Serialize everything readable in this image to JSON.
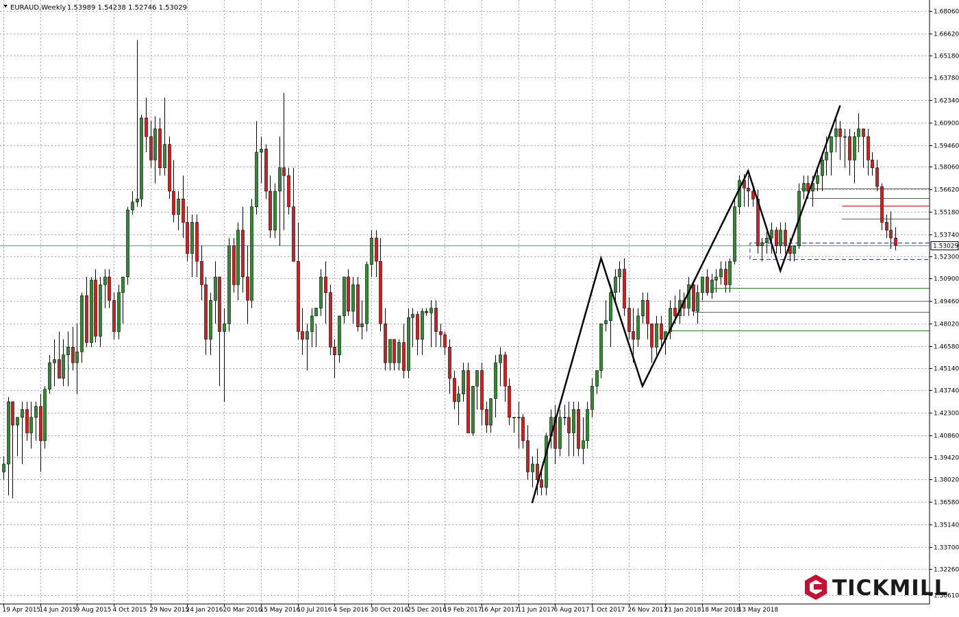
{
  "header": {
    "symbol": "EURAUD,Weekly",
    "ohlc": "1.53989 1.54238 1.52746 1.53029"
  },
  "brand": {
    "name": "TICKMILL",
    "logo_icon": "tickmill-hexagon-logo-icon",
    "color": "#c8102e"
  },
  "colors": {
    "bull": "#2e8b2e",
    "bear": "#d21e1e",
    "wick": "#000000",
    "grid": "#a9a9a9",
    "zigzag": "#000000",
    "resistance": "#e02020",
    "support": "#2e8b2e",
    "zone": "#2233cc",
    "current_price_line": "#7a8a99"
  },
  "chart_data": {
    "type": "candlestick",
    "title": "EURAUD,Weekly",
    "timeframe": "Weekly",
    "ylim": [
      1.3003,
      1.6876
    ],
    "y_ticks": [
      "1.30610",
      "1.32260",
      "1.33700",
      "1.35140",
      "1.36580",
      "1.38020",
      "1.39420",
      "1.40860",
      "1.42300",
      "1.43740",
      "1.45140",
      "1.46580",
      "1.48020",
      "1.49460",
      "1.50900",
      "1.52300",
      "1.53740",
      "1.55180",
      "1.56620",
      "1.58060",
      "1.59460",
      "1.60900",
      "1.62340",
      "1.63780",
      "1.65180",
      "1.66620",
      "1.68060"
    ],
    "x_ticks": [
      "19 Apr 2015",
      "14 Jun 2015",
      "9 Aug 2015",
      "4 Oct 2015",
      "29 Nov 2015",
      "24 Jan 2016",
      "20 Mar 2016",
      "15 May 2016",
      "10 Jul 2016",
      "4 Sep 2016",
      "30 Oct 2016",
      "25 Dec 2016",
      "19 Feb 2017",
      "16 Apr 2017",
      "11 Jun 2017",
      "6 Aug 2017",
      "1 Oct 2017",
      "26 Nov 2017",
      "21 Jan 2018",
      "18 Mar 2018",
      "13 May 2018"
    ],
    "first_week": "19 Apr 2015",
    "current_price": "1.53029",
    "grid": true,
    "candles": [
      [
        1.385,
        1.395,
        1.38,
        1.39
      ],
      [
        1.39,
        1.433,
        1.37,
        1.43
      ],
      [
        1.43,
        1.425,
        1.368,
        1.415
      ],
      [
        1.415,
        1.42,
        1.395,
        1.42
      ],
      [
        1.42,
        1.43,
        1.39,
        1.425
      ],
      [
        1.425,
        1.43,
        1.405,
        1.41
      ],
      [
        1.41,
        1.43,
        1.4,
        1.42
      ],
      [
        1.42,
        1.43,
        1.405,
        1.427
      ],
      [
        1.427,
        1.435,
        1.385,
        1.405
      ],
      [
        1.405,
        1.44,
        1.4,
        1.438
      ],
      [
        1.438,
        1.46,
        1.435,
        1.455
      ],
      [
        1.455,
        1.47,
        1.44,
        1.457
      ],
      [
        1.457,
        1.475,
        1.445,
        1.445
      ],
      [
        1.445,
        1.47,
        1.44,
        1.46
      ],
      [
        1.46,
        1.475,
        1.44,
        1.465
      ],
      [
        1.465,
        1.478,
        1.45,
        1.455
      ],
      [
        1.455,
        1.48,
        1.435,
        1.462
      ],
      [
        1.462,
        1.5,
        1.455,
        1.498
      ],
      [
        1.498,
        1.51,
        1.465,
        1.468
      ],
      [
        1.468,
        1.51,
        1.465,
        1.508
      ],
      [
        1.508,
        1.515,
        1.468,
        1.472
      ],
      [
        1.472,
        1.51,
        1.465,
        1.505
      ],
      [
        1.505,
        1.515,
        1.49,
        1.51
      ],
      [
        1.51,
        1.515,
        1.49,
        1.495
      ],
      [
        1.495,
        1.5,
        1.47,
        1.475
      ],
      [
        1.475,
        1.505,
        1.47,
        1.5
      ],
      [
        1.5,
        1.51,
        1.48,
        1.51
      ],
      [
        1.51,
        1.555,
        1.505,
        1.553
      ],
      [
        1.553,
        1.565,
        1.55,
        1.558
      ],
      [
        1.558,
        1.662,
        1.555,
        1.56
      ],
      [
        1.56,
        1.614,
        1.555,
        1.612
      ],
      [
        1.612,
        1.625,
        1.59,
        1.6
      ],
      [
        1.6,
        1.61,
        1.58,
        1.585
      ],
      [
        1.585,
        1.613,
        1.57,
        1.605
      ],
      [
        1.605,
        1.612,
        1.575,
        1.58
      ],
      [
        1.58,
        1.625,
        1.575,
        1.595
      ],
      [
        1.595,
        1.6,
        1.56,
        1.565
      ],
      [
        1.565,
        1.585,
        1.545,
        1.55
      ],
      [
        1.55,
        1.565,
        1.54,
        1.56
      ],
      [
        1.56,
        1.575,
        1.535,
        1.545
      ],
      [
        1.545,
        1.555,
        1.52,
        1.525
      ],
      [
        1.525,
        1.55,
        1.51,
        1.545
      ],
      [
        1.545,
        1.55,
        1.51,
        1.52
      ],
      [
        1.52,
        1.53,
        1.495,
        1.505
      ],
      [
        1.505,
        1.51,
        1.46,
        1.47
      ],
      [
        1.47,
        1.5,
        1.46,
        1.495
      ],
      [
        1.495,
        1.52,
        1.48,
        1.51
      ],
      [
        1.51,
        1.51,
        1.44,
        1.475
      ],
      [
        1.475,
        1.49,
        1.43,
        1.48
      ],
      [
        1.48,
        1.535,
        1.475,
        1.53
      ],
      [
        1.53,
        1.535,
        1.5,
        1.505
      ],
      [
        1.505,
        1.545,
        1.495,
        1.54
      ],
      [
        1.54,
        1.555,
        1.5,
        1.51
      ],
      [
        1.51,
        1.53,
        1.48,
        1.495
      ],
      [
        1.495,
        1.56,
        1.49,
        1.555
      ],
      [
        1.555,
        1.61,
        1.55,
        1.59
      ],
      [
        1.59,
        1.6,
        1.57,
        1.592
      ],
      [
        1.592,
        1.595,
        1.56,
        1.565
      ],
      [
        1.565,
        1.575,
        1.535,
        1.54
      ],
      [
        1.54,
        1.57,
        1.535,
        1.565
      ],
      [
        1.565,
        1.6,
        1.53,
        1.58
      ],
      [
        1.58,
        1.628,
        1.54,
        1.575
      ],
      [
        1.575,
        1.58,
        1.55,
        1.555
      ],
      [
        1.555,
        1.58,
        1.52,
        1.52
      ],
      [
        1.52,
        1.545,
        1.47,
        1.475
      ],
      [
        1.475,
        1.49,
        1.46,
        1.47
      ],
      [
        1.47,
        1.48,
        1.45,
        1.475
      ],
      [
        1.475,
        1.49,
        1.465,
        1.485
      ],
      [
        1.485,
        1.48,
        1.465,
        1.49
      ],
      [
        1.49,
        1.515,
        1.485,
        1.51
      ],
      [
        1.51,
        1.52,
        1.48,
        1.5
      ],
      [
        1.5,
        1.505,
        1.46,
        1.465
      ],
      [
        1.465,
        1.47,
        1.445,
        1.46
      ],
      [
        1.46,
        1.47,
        1.455,
        1.485
      ],
      [
        1.485,
        1.5,
        1.48,
        1.51
      ],
      [
        1.51,
        1.515,
        1.485,
        1.488
      ],
      [
        1.488,
        1.51,
        1.48,
        1.505
      ],
      [
        1.505,
        1.51,
        1.475,
        1.478
      ],
      [
        1.478,
        1.495,
        1.47,
        1.48
      ],
      [
        1.48,
        1.52,
        1.475,
        1.518
      ],
      [
        1.518,
        1.54,
        1.51,
        1.535
      ],
      [
        1.535,
        1.54,
        1.51,
        1.52
      ],
      [
        1.52,
        1.535,
        1.475,
        1.48
      ],
      [
        1.48,
        1.49,
        1.45,
        1.455
      ],
      [
        1.455,
        1.46,
        1.45,
        1.47
      ],
      [
        1.47,
        1.47,
        1.45,
        1.455
      ],
      [
        1.455,
        1.47,
        1.45,
        1.468
      ],
      [
        1.468,
        1.48,
        1.445,
        1.45
      ],
      [
        1.45,
        1.49,
        1.445,
        1.484
      ],
      [
        1.484,
        1.49,
        1.465,
        1.486
      ],
      [
        1.486,
        1.488,
        1.46,
        1.47
      ],
      [
        1.47,
        1.49,
        1.46,
        1.488
      ],
      [
        1.488,
        1.49,
        1.485,
        1.487
      ],
      [
        1.487,
        1.495,
        1.465,
        1.49
      ],
      [
        1.49,
        1.495,
        1.465,
        1.475
      ],
      [
        1.475,
        1.48,
        1.465,
        1.473
      ],
      [
        1.473,
        1.475,
        1.46,
        1.465
      ],
      [
        1.465,
        1.47,
        1.435,
        1.445
      ],
      [
        1.445,
        1.45,
        1.425,
        1.43
      ],
      [
        1.43,
        1.44,
        1.415,
        1.435
      ],
      [
        1.435,
        1.455,
        1.43,
        1.45
      ],
      [
        1.45,
        1.455,
        1.41,
        1.41
      ],
      [
        1.41,
        1.44,
        1.408,
        1.44
      ],
      [
        1.44,
        1.45,
        1.425,
        1.45
      ],
      [
        1.45,
        1.455,
        1.415,
        1.425
      ],
      [
        1.425,
        1.43,
        1.41,
        1.415
      ],
      [
        1.415,
        1.42,
        1.41,
        1.432
      ],
      [
        1.432,
        1.46,
        1.42,
        1.455
      ],
      [
        1.455,
        1.465,
        1.44,
        1.46
      ],
      [
        1.46,
        1.462,
        1.43,
        1.44
      ],
      [
        1.44,
        1.445,
        1.415,
        1.42
      ],
      [
        1.42,
        1.42,
        1.41,
        1.42
      ],
      [
        1.42,
        1.43,
        1.4,
        1.42
      ],
      [
        1.42,
        1.422,
        1.4,
        1.405
      ],
      [
        1.405,
        1.415,
        1.38,
        1.385
      ],
      [
        1.385,
        1.395,
        1.375,
        1.39
      ],
      [
        1.39,
        1.4,
        1.37,
        1.38
      ],
      [
        1.38,
        1.385,
        1.37,
        1.375
      ],
      [
        1.375,
        1.41,
        1.37,
        1.408
      ],
      [
        1.408,
        1.425,
        1.4,
        1.42
      ],
      [
        1.42,
        1.428,
        1.39,
        1.4
      ],
      [
        1.4,
        1.425,
        1.395,
        1.42
      ],
      [
        1.42,
        1.428,
        1.415,
        1.42
      ],
      [
        1.42,
        1.43,
        1.395,
        1.41
      ],
      [
        1.41,
        1.43,
        1.395,
        1.425
      ],
      [
        1.425,
        1.43,
        1.395,
        1.4
      ],
      [
        1.4,
        1.42,
        1.39,
        1.405
      ],
      [
        1.405,
        1.43,
        1.4,
        1.425
      ],
      [
        1.425,
        1.445,
        1.42,
        1.44
      ],
      [
        1.44,
        1.45,
        1.435,
        1.45
      ],
      [
        1.45,
        1.48,
        1.445,
        1.48
      ],
      [
        1.48,
        1.495,
        1.475,
        1.482
      ],
      [
        1.482,
        1.505,
        1.465,
        1.5
      ],
      [
        1.5,
        1.515,
        1.495,
        1.51
      ],
      [
        1.51,
        1.52,
        1.5,
        1.515
      ],
      [
        1.515,
        1.522,
        1.485,
        1.49
      ],
      [
        1.49,
        1.497,
        1.47,
        1.475
      ],
      [
        1.475,
        1.49,
        1.455,
        1.47
      ],
      [
        1.47,
        1.49,
        1.465,
        1.485
      ],
      [
        1.485,
        1.5,
        1.48,
        1.495
      ],
      [
        1.495,
        1.5,
        1.47,
        1.48
      ],
      [
        1.48,
        1.48,
        1.455,
        1.465
      ],
      [
        1.465,
        1.485,
        1.46,
        1.48
      ],
      [
        1.48,
        1.485,
        1.465,
        1.47
      ],
      [
        1.47,
        1.475,
        1.46,
        1.475
      ],
      [
        1.475,
        1.495,
        1.47,
        1.49
      ],
      [
        1.49,
        1.498,
        1.48,
        1.485
      ],
      [
        1.485,
        1.502,
        1.48,
        1.495
      ],
      [
        1.495,
        1.5,
        1.485,
        1.49
      ],
      [
        1.49,
        1.51,
        1.485,
        1.505
      ],
      [
        1.505,
        1.508,
        1.485,
        1.488
      ],
      [
        1.488,
        1.505,
        1.48,
        1.5
      ],
      [
        1.5,
        1.51,
        1.495,
        1.51
      ],
      [
        1.51,
        1.515,
        1.498,
        1.5
      ],
      [
        1.5,
        1.512,
        1.496,
        1.508
      ],
      [
        1.508,
        1.515,
        1.5,
        1.51
      ],
      [
        1.51,
        1.52,
        1.505,
        1.515
      ],
      [
        1.515,
        1.52,
        1.5,
        1.505
      ],
      [
        1.505,
        1.522,
        1.5,
        1.52
      ],
      [
        1.52,
        1.56,
        1.518,
        1.555
      ],
      [
        1.555,
        1.575,
        1.55,
        1.572
      ],
      [
        1.572,
        1.576,
        1.555,
        1.567
      ],
      [
        1.567,
        1.575,
        1.555,
        1.565
      ],
      [
        1.565,
        1.57,
        1.555,
        1.56
      ],
      [
        1.56,
        1.566,
        1.525,
        1.53
      ],
      [
        1.53,
        1.535,
        1.52,
        1.532
      ],
      [
        1.532,
        1.54,
        1.525,
        1.535
      ],
      [
        1.535,
        1.545,
        1.525,
        1.54
      ],
      [
        1.54,
        1.542,
        1.525,
        1.53
      ],
      [
        1.53,
        1.545,
        1.525,
        1.54
      ],
      [
        1.54,
        1.545,
        1.525,
        1.53
      ],
      [
        1.53,
        1.535,
        1.52,
        1.525
      ],
      [
        1.525,
        1.53,
        1.52,
        1.53
      ],
      [
        1.53,
        1.57,
        1.528,
        1.565
      ],
      [
        1.565,
        1.575,
        1.56,
        1.57
      ],
      [
        1.57,
        1.575,
        1.56,
        1.565
      ],
      [
        1.565,
        1.575,
        1.555,
        1.57
      ],
      [
        1.57,
        1.58,
        1.565,
        1.575
      ],
      [
        1.575,
        1.59,
        1.565,
        1.585
      ],
      [
        1.585,
        1.6,
        1.575,
        1.59
      ],
      [
        1.59,
        1.6,
        1.575,
        1.6
      ],
      [
        1.6,
        1.612,
        1.59,
        1.605
      ],
      [
        1.605,
        1.61,
        1.585,
        1.6
      ],
      [
        1.6,
        1.605,
        1.58,
        1.6
      ],
      [
        1.6,
        1.605,
        1.575,
        1.585
      ],
      [
        1.585,
        1.603,
        1.57,
        1.6
      ],
      [
        1.6,
        1.615,
        1.59,
        1.605
      ],
      [
        1.605,
        1.605,
        1.58,
        1.6
      ],
      [
        1.6,
        1.605,
        1.575,
        1.585
      ],
      [
        1.585,
        1.59,
        1.575,
        1.58
      ],
      [
        1.58,
        1.585,
        1.565,
        1.568
      ],
      [
        1.568,
        1.57,
        1.54,
        1.545
      ],
      [
        1.545,
        1.55,
        1.535,
        1.54
      ],
      [
        1.54,
        1.552,
        1.528,
        1.535
      ],
      [
        1.535,
        1.542,
        1.527,
        1.53029
      ]
    ],
    "zigzag": [
      [
        115,
        1.365
      ],
      [
        130,
        1.522
      ],
      [
        139,
        1.44
      ],
      [
        162,
        1.578
      ],
      [
        169,
        1.514
      ],
      [
        182,
        1.62
      ]
    ],
    "resistance_lines": [
      {
        "start": 174,
        "price": 1.5665
      },
      {
        "start": 176,
        "price": 1.5605
      },
      {
        "start": 183,
        "price": 1.5555
      },
      {
        "start": 183,
        "price": 1.5475
      }
    ],
    "support_lines": [
      {
        "start": 155,
        "price": 1.5028
      },
      {
        "start": 152,
        "price": 1.4945
      },
      {
        "start": 151,
        "price": 1.4875
      },
      {
        "start": 146,
        "price": 1.4755
      }
    ],
    "demand_zone": {
      "start": 163,
      "top": 1.532,
      "bottom": 1.5215
    }
  }
}
